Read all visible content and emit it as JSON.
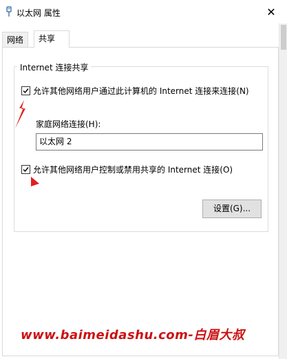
{
  "window": {
    "title": "以太网 属性",
    "close_glyph": "✕"
  },
  "tabs": [
    {
      "label": "网络",
      "active": false
    },
    {
      "label": "共享",
      "active": true
    }
  ],
  "sharing": {
    "group_title": "Internet 连接共享",
    "allow_connect": {
      "label": "允许其他网络用户通过此计算机的 Internet 连接来连接(N)",
      "checked": true
    },
    "home_network_label": "家庭网络连接(H):",
    "home_network_value": "以太网 2",
    "allow_control": {
      "label": "允许其他网络用户控制或禁用共享的 Internet 连接(O)",
      "checked": true
    },
    "settings_button": "设置(G)..."
  },
  "watermark": "www.baimeidashu.com-白眉大叔",
  "colors": {
    "annotation_red": "#e02020",
    "watermark_red": "#cc1111"
  },
  "icons": {
    "title": "network-adapter-icon",
    "close": "close-icon",
    "check": "checkmark-icon",
    "arrow": "red-arrow-icon"
  }
}
